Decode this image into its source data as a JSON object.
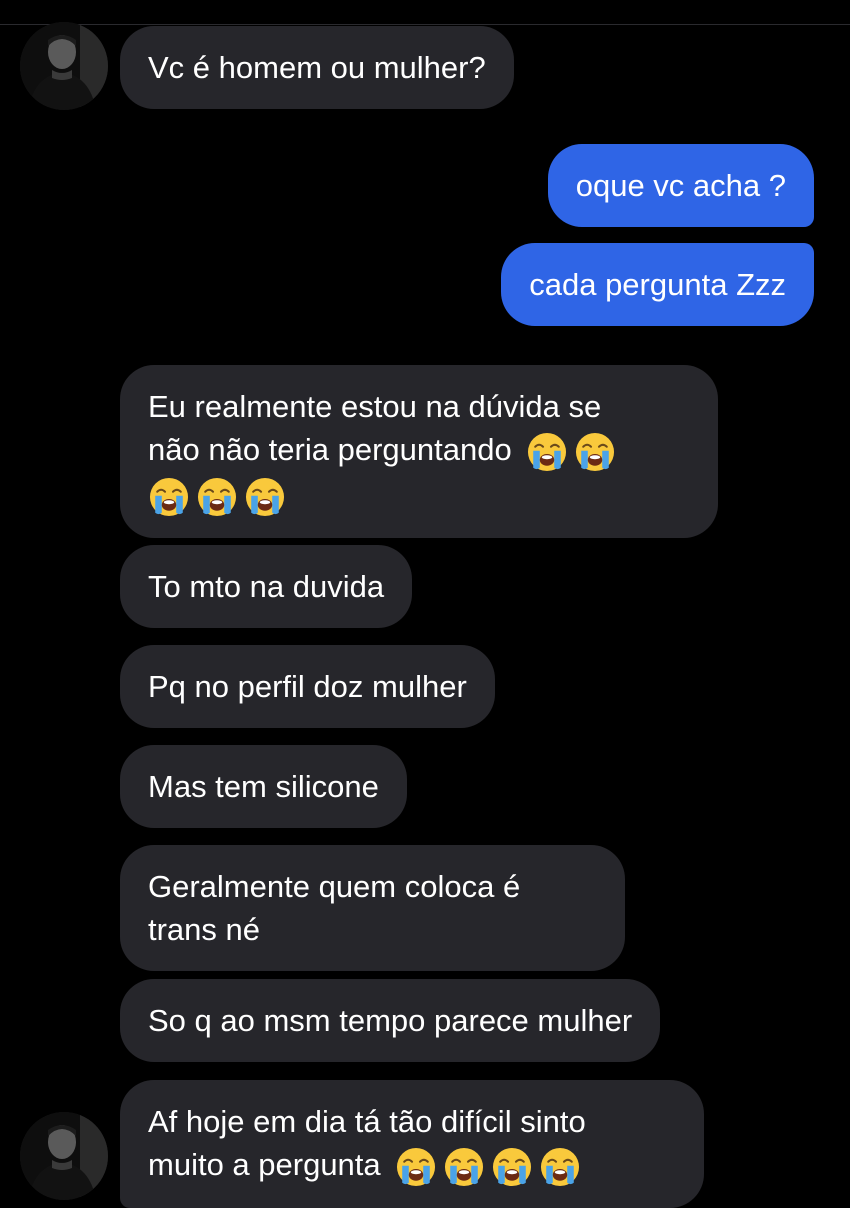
{
  "conversation": {
    "messages": [
      {
        "side": "incoming",
        "text": "Vc é homem ou mulher?"
      },
      {
        "side": "outgoing",
        "text": "oque vc acha ?"
      },
      {
        "side": "outgoing",
        "text": "cada pergunta Zzz"
      },
      {
        "side": "incoming",
        "line1": "Eu realmente estou na dúvida se",
        "line2": "não não teria perguntando",
        "emoji": "loudly-crying-face",
        "emoji_count_line2": 2,
        "emoji_count_line3": 3
      },
      {
        "side": "incoming",
        "text": "To mto na duvida"
      },
      {
        "side": "incoming",
        "text": "Pq no perfil doz mulher"
      },
      {
        "side": "incoming",
        "text": "Mas tem silicone"
      },
      {
        "side": "incoming",
        "line1": "Geralmente quem coloca é",
        "line2": "trans né"
      },
      {
        "side": "incoming",
        "text": "So q ao msm tempo parece mulher"
      },
      {
        "side": "incoming",
        "line1": "Af hoje em dia tá tão difícil sinto",
        "line2": "muito a pergunta",
        "emoji": "loudly-crying-face",
        "emoji_count_line2": 4
      }
    ]
  },
  "colors": {
    "background": "#000000",
    "incoming_bubble": "#26262b",
    "outgoing_bubble": "#2f65e6",
    "text": "#ffffff"
  },
  "icons": {
    "avatar": "contact-avatar",
    "emoji": "loudly-crying-face"
  }
}
